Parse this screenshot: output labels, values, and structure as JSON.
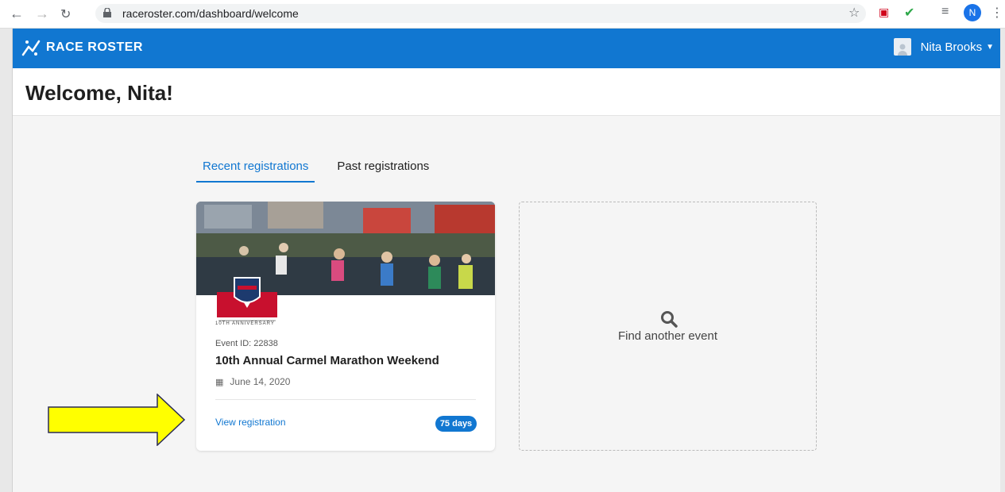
{
  "browser": {
    "url": "raceroster.com/dashboard/welcome",
    "profile_initial": "N"
  },
  "topnav": {
    "brand": "RACE ROSTER",
    "user_name": "Nita Brooks"
  },
  "header": {
    "title": "Welcome, Nita!"
  },
  "tabs": [
    {
      "label": "Recent registrations",
      "active": true
    },
    {
      "label": "Past registrations",
      "active": false
    }
  ],
  "event_card": {
    "event_id_text": "Event ID: 22838",
    "title": "10th Annual Carmel Marathon Weekend",
    "date": "June 14, 2020",
    "view_link": "View registration",
    "days_badge": "75 days",
    "emblem_text": "10TH ANNIVERSARY"
  },
  "find_card": {
    "label": "Find another event"
  },
  "colors": {
    "brand_blue": "#1177d1",
    "arrow_yellow": "#ffff00"
  }
}
